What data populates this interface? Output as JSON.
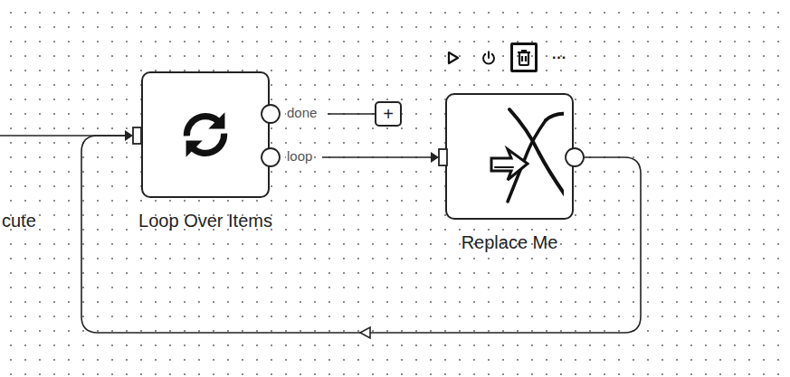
{
  "nodes": [
    {
      "label": "cute",
      "kind": "offscreen"
    },
    {
      "label": "Loop Over Items",
      "kind": "loop",
      "outputs": [
        "done",
        "loop"
      ]
    },
    {
      "label": "Replace Me",
      "kind": "noop",
      "toolbar": [
        {
          "kind": "play",
          "selected": false
        },
        {
          "kind": "power",
          "selected": false
        },
        {
          "kind": "trash",
          "selected": true
        },
        {
          "kind": "more",
          "text": "···",
          "selected": false
        }
      ]
    }
  ],
  "add_button": "+"
}
